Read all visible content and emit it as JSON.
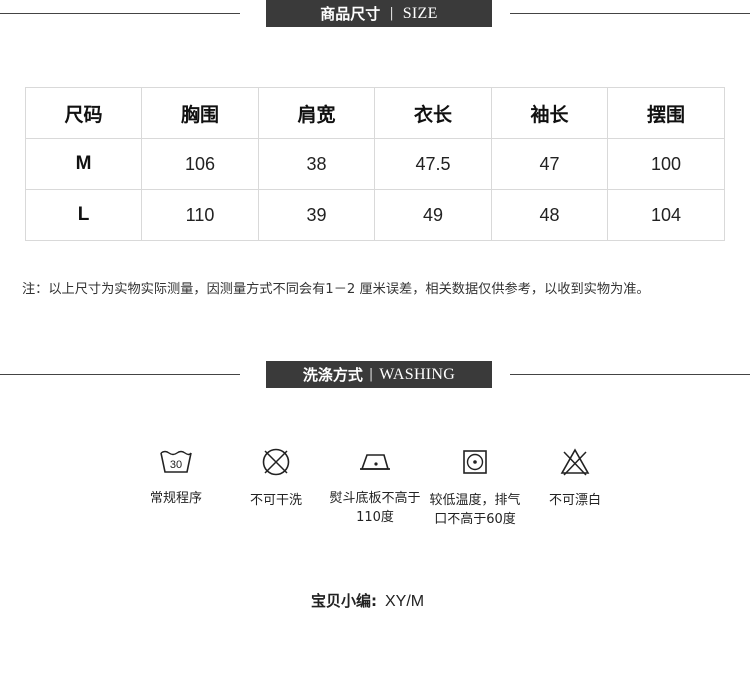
{
  "size_section": {
    "title_cn": "商品尺寸",
    "separator": "|",
    "title_en": "SIZE"
  },
  "size_table": {
    "headers": [
      "尺码",
      "胸围",
      "肩宽",
      "衣长",
      "袖长",
      "摆围"
    ],
    "rows": [
      [
        "M",
        "106",
        "38",
        "47.5",
        "47",
        "100"
      ],
      [
        "L",
        "110",
        "39",
        "49",
        "48",
        "104"
      ]
    ]
  },
  "note": "注：以上尺寸为实物实际测量，因测量方式不同会有1－2 厘米误差，相关数据仅供参考，以收到实物为准。",
  "wash_section": {
    "title_cn": "洗涤方式",
    "separator": "|",
    "title_en": "WASHING"
  },
  "care": [
    {
      "icon": "wash-30-icon",
      "badge": "30",
      "label_lines": [
        "常规程序"
      ]
    },
    {
      "icon": "no-dry-clean-icon",
      "label_lines": [
        "不可干洗"
      ]
    },
    {
      "icon": "iron-low-icon",
      "label_lines": [
        "熨斗底板不高于",
        "110度"
      ]
    },
    {
      "icon": "tumble-dry-low-icon",
      "label_lines": [
        "较低温度，排气",
        "口不高于60度"
      ]
    },
    {
      "icon": "no-bleach-icon",
      "label_lines": [
        "不可漂白"
      ]
    }
  ],
  "editor": {
    "label": "宝贝小编:",
    "value": "XY/M"
  }
}
